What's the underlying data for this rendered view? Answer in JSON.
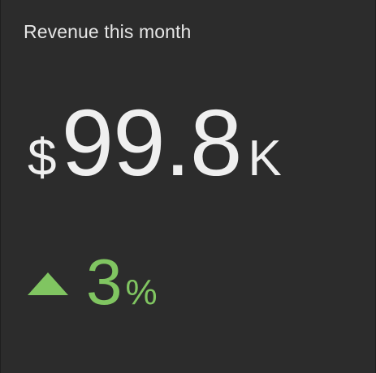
{
  "widget": {
    "title": "Revenue this month",
    "metric": {
      "prefix": "$",
      "value": "99.8",
      "suffix": "K"
    },
    "delta": {
      "direction_icon": "triangle-up-icon",
      "value": "3",
      "unit": "%",
      "color": "#80c561"
    },
    "background_color": "#2c2c2c"
  }
}
